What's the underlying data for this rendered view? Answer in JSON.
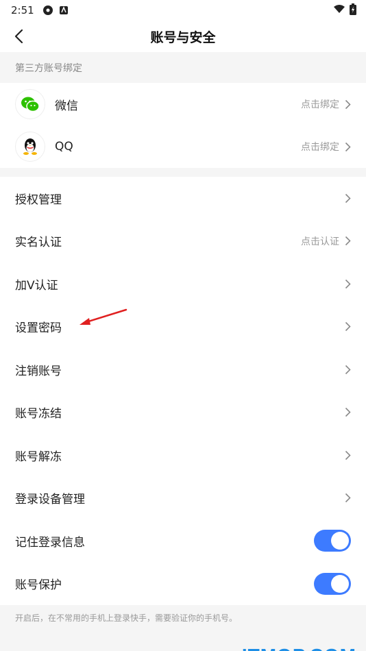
{
  "status_bar": {
    "time": "2:51"
  },
  "header": {
    "title": "账号与安全"
  },
  "third_party": {
    "section_title": "第三方账号绑定",
    "items": [
      {
        "label": "微信",
        "action": "点击绑定",
        "icon": "wechat-icon"
      },
      {
        "label": "QQ",
        "action": "点击绑定",
        "icon": "qq-icon"
      }
    ]
  },
  "settings": {
    "items": [
      {
        "label": "授权管理",
        "hint": ""
      },
      {
        "label": "实名认证",
        "hint": "点击认证"
      },
      {
        "label": "加V认证",
        "hint": ""
      },
      {
        "label": "设置密码",
        "hint": ""
      },
      {
        "label": "注销账号",
        "hint": ""
      },
      {
        "label": "账号冻结",
        "hint": ""
      },
      {
        "label": "账号解冻",
        "hint": ""
      },
      {
        "label": "登录设备管理",
        "hint": ""
      }
    ],
    "toggles": [
      {
        "label": "记住登录信息",
        "on": true
      },
      {
        "label": "账号保护",
        "on": true
      }
    ]
  },
  "footer_note": "开启后，在不常用的手机上登录快手，需要验证你的手机号。",
  "watermark": "ITMOP.COM",
  "colors": {
    "accent": "#3d7bff",
    "wechat": "#2dc100",
    "annotation_arrow": "#e02020",
    "watermark": "#1d8ee6"
  }
}
